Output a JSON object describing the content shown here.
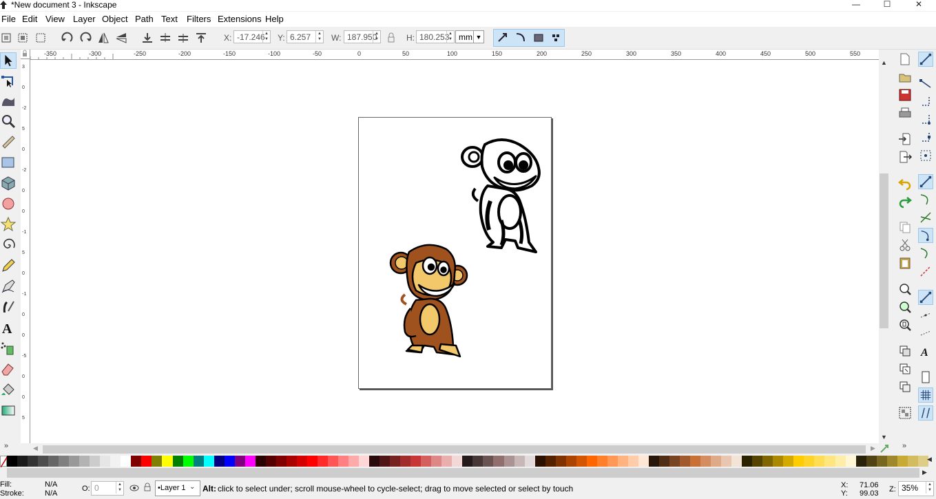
{
  "window": {
    "title": "*New document 3 - Inkscape",
    "controls": {
      "minimize": "—",
      "maximize": "☐",
      "close": "✕"
    }
  },
  "menubar": {
    "items": [
      "File",
      "Edit",
      "View",
      "Layer",
      "Object",
      "Path",
      "Text",
      "Filters",
      "Extensions",
      "Help"
    ]
  },
  "toolbar": {
    "x_label": "X:",
    "x_value": "-17.246",
    "y_label": "Y:",
    "y_value": "6.257",
    "w_label": "W:",
    "w_value": "187.950",
    "h_label": "H:",
    "h_value": "180.253",
    "unit": "mm"
  },
  "rulers": {
    "horizontal_ticks": [
      "-350",
      "-300",
      "-250",
      "-200",
      "-150",
      "-100",
      "-50",
      "0",
      "50",
      "100",
      "150",
      "200",
      "250",
      "300",
      "350",
      "400",
      "450",
      "500",
      "550"
    ],
    "vertical_ticks": [
      "3",
      "0",
      "-2",
      "5",
      "0",
      "-2",
      "0",
      "0",
      "-1",
      "5",
      "0",
      "-1",
      "0",
      "0",
      "-5",
      "0",
      "0",
      "5"
    ]
  },
  "palette": {
    "colors": [
      "#000000",
      "#1a1a1a",
      "#333333",
      "#4d4d4d",
      "#666666",
      "#808080",
      "#999999",
      "#b3b3b3",
      "#cccccc",
      "#e6e6e6",
      "#f2f2f2",
      "#ffffff",
      "#800000",
      "#ff0000",
      "#808000",
      "#ffff00",
      "#008000",
      "#00ff00",
      "#008080",
      "#00ffff",
      "#000080",
      "#0000ff",
      "#800080",
      "#ff00ff",
      "#2b0000",
      "#550000",
      "#800000",
      "#aa0000",
      "#d40000",
      "#ff0000",
      "#ff2a2a",
      "#ff5555",
      "#ff8080",
      "#ffaaaa",
      "#ffd5d5",
      "#280b0b",
      "#501616",
      "#782121",
      "#a02c2c",
      "#c83737",
      "#d35f5f",
      "#de8787",
      "#e9afaf",
      "#f4d7d7",
      "#241c1c",
      "#483737",
      "#6c5353",
      "#916f6f",
      "#ac9393",
      "#c8b7b7",
      "#e3dbdb",
      "#2b1100",
      "#552200",
      "#803300",
      "#aa4400",
      "#d45500",
      "#ff6600",
      "#ff7f2a",
      "#ff9955",
      "#ffb380",
      "#ffccaa",
      "#ffe6d5",
      "#28170b",
      "#502d16",
      "#784421",
      "#a05a2c",
      "#c87137",
      "#d38d5f",
      "#deaa87",
      "#e9c6af",
      "#f4e3d7",
      "#2b2200",
      "#554400",
      "#806600",
      "#aa8800",
      "#d4aa00",
      "#ffcc00",
      "#ffd42a",
      "#ffdd55",
      "#ffe680",
      "#ffeeaa",
      "#fff6d5",
      "#28220b",
      "#504416",
      "#786721",
      "#a0892c",
      "#c8ab37",
      "#d3bc5f",
      "#decd87"
    ]
  },
  "statusbar": {
    "fill_label": "Fill:",
    "fill_value": "N/A",
    "stroke_label": "Stroke:",
    "stroke_value": "N/A",
    "opacity_label": "O:",
    "opacity_value": "0",
    "layer": "•Layer 1",
    "message_key": "Alt:",
    "message": "click to select under; scroll mouse-wheel to cycle-select; drag to move selected or select by touch",
    "x_label": "X:",
    "x_value": "71.06",
    "y_label": "Y:",
    "y_value": "99.03",
    "zoom_label": "Z:",
    "zoom_value": "35%"
  },
  "artwork": {
    "fill_brown": "#a0521e",
    "fill_tan": "#f3c86a",
    "outline": "#000000"
  }
}
